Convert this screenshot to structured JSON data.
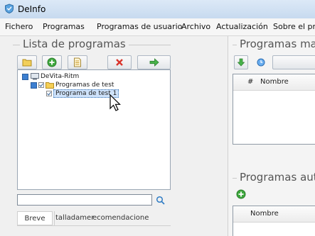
{
  "window": {
    "title": "DeInfo",
    "accent": "#3a7fc0"
  },
  "menu": [
    "Fichero",
    "Programas",
    "Programas de usuario",
    "Archivo",
    "Actualización",
    "Sobre el pro"
  ],
  "left": {
    "group_title": "Lista de programas",
    "toolbar": [
      {
        "name": "open-folder-icon"
      },
      {
        "name": "add-icon"
      },
      {
        "name": "document-icon"
      },
      {
        "name": "delete-icon"
      },
      {
        "name": "forward-arrow-icon"
      }
    ],
    "tree": [
      {
        "label": "DeVita-Ritm",
        "level": 0
      },
      {
        "label": "Programas de test",
        "level": 1
      },
      {
        "label": "Programa de test 1",
        "level": 2,
        "selected": true
      }
    ],
    "search": {
      "value": "",
      "placeholder": ""
    },
    "tabs": [
      "Breve",
      "talladamer",
      "ecomendacione"
    ]
  },
  "right": {
    "manual": {
      "title": "Programas man",
      "columns": [
        "#",
        "Nombre"
      ]
    },
    "auto": {
      "title": "Programas auto",
      "columns": [
        "Nombre"
      ]
    }
  }
}
